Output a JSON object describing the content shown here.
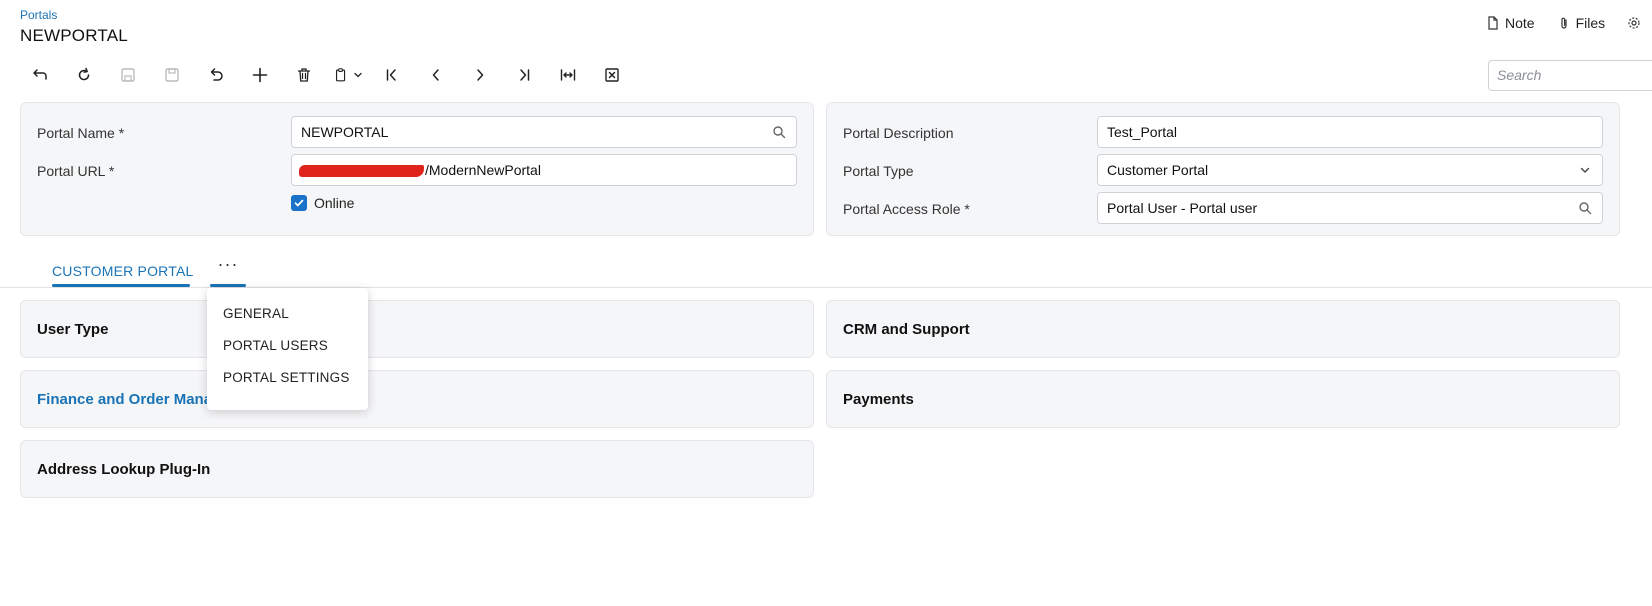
{
  "header": {
    "breadcrumb": "Portals",
    "title": "NEWPORTAL",
    "actions": [
      {
        "label": "Note",
        "icon": "note-icon"
      },
      {
        "label": "Files",
        "icon": "paperclip-icon"
      }
    ]
  },
  "toolbar": {
    "buttons": [
      "back",
      "refresh",
      "save-close",
      "save",
      "undo",
      "add",
      "delete",
      "copy-paste",
      "first",
      "previous",
      "next",
      "last",
      "fit-columns",
      "export-excel"
    ],
    "search_placeholder": "Search"
  },
  "form": {
    "left": {
      "portal_name_label": "Portal Name",
      "portal_name_value": "NEWPORTAL",
      "portal_url_label": "Portal URL",
      "portal_url_value": "/ModernNewPortal",
      "online_label": "Online",
      "online_checked": true
    },
    "right": {
      "portal_description_label": "Portal Description",
      "portal_description_value": "Test_Portal",
      "portal_type_label": "Portal Type",
      "portal_type_value": "Customer Portal",
      "portal_access_role_label": "Portal Access Role",
      "portal_access_role_value": "Portal User - Portal user"
    },
    "required_marker": "*"
  },
  "tabs": {
    "active": "CUSTOMER PORTAL",
    "more": "···"
  },
  "more_menu": {
    "items": [
      "GENERAL",
      "PORTAL USERS",
      "PORTAL SETTINGS"
    ]
  },
  "sections": {
    "user_type": "User Type",
    "crm_support": "CRM and Support",
    "finance_order": "Finance and Order Management",
    "payments": "Payments",
    "address_lookup": "Address Lookup Plug-In"
  },
  "colors": {
    "accent": "#1a73b5",
    "panel_bg": "#f5f6f8",
    "redaction": "#e0231b"
  }
}
